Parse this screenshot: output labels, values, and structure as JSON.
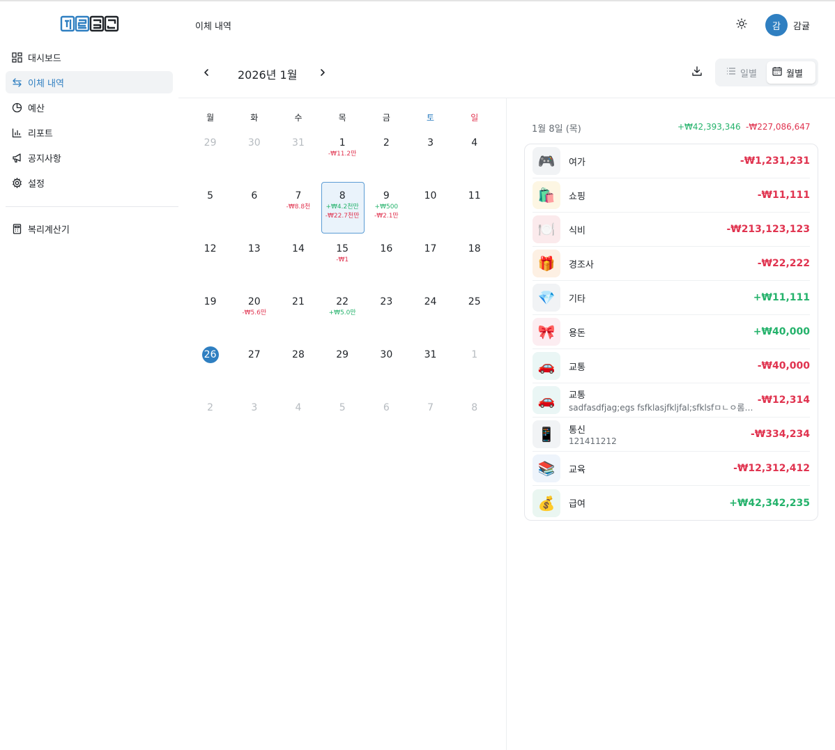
{
  "app": {
    "logo_text": "하루입금"
  },
  "sidebar": {
    "items": [
      {
        "label": "대시보드",
        "icon": "dashboard-icon",
        "active": false
      },
      {
        "label": "이체 내역",
        "icon": "transfer-icon",
        "active": true
      },
      {
        "label": "예산",
        "icon": "pie-chart-icon",
        "active": false
      },
      {
        "label": "리포트",
        "icon": "bar-chart-icon",
        "active": false
      },
      {
        "label": "공지사항",
        "icon": "megaphone-icon",
        "active": false
      },
      {
        "label": "설정",
        "icon": "gear-icon",
        "active": false
      }
    ],
    "tools": [
      {
        "label": "복리계산기",
        "icon": "calculator-icon"
      }
    ]
  },
  "header": {
    "title": "이체 내역",
    "avatar_initial": "감",
    "user_name": "감귤"
  },
  "calendar": {
    "month_label": "2026년 1월",
    "view_daily": "일별",
    "view_monthly": "월별",
    "selected_view": "월별",
    "weekdays": [
      "월",
      "화",
      "수",
      "목",
      "금",
      "토",
      "일"
    ],
    "days": [
      {
        "d": "29",
        "other": true
      },
      {
        "d": "30",
        "other": true
      },
      {
        "d": "31",
        "other": true
      },
      {
        "d": "1",
        "exp": "-₩11.2만"
      },
      {
        "d": "2"
      },
      {
        "d": "3"
      },
      {
        "d": "4"
      },
      {
        "d": "5"
      },
      {
        "d": "6"
      },
      {
        "d": "7",
        "exp": "-₩8.8천"
      },
      {
        "d": "8",
        "inc": "+₩4.2천만",
        "exp": "-₩22.7천만",
        "selected": true
      },
      {
        "d": "9",
        "inc": "+₩500",
        "exp": "-₩2.1만"
      },
      {
        "d": "10"
      },
      {
        "d": "11"
      },
      {
        "d": "12"
      },
      {
        "d": "13"
      },
      {
        "d": "14"
      },
      {
        "d": "15",
        "exp": "-₩1"
      },
      {
        "d": "16"
      },
      {
        "d": "17"
      },
      {
        "d": "18"
      },
      {
        "d": "19"
      },
      {
        "d": "20",
        "exp": "-₩5.6만"
      },
      {
        "d": "21"
      },
      {
        "d": "22",
        "inc": "+₩5.0만"
      },
      {
        "d": "23"
      },
      {
        "d": "24"
      },
      {
        "d": "25"
      },
      {
        "d": "26",
        "today": true
      },
      {
        "d": "27"
      },
      {
        "d": "28"
      },
      {
        "d": "29"
      },
      {
        "d": "30"
      },
      {
        "d": "31"
      },
      {
        "d": "1",
        "other": true
      },
      {
        "d": "2",
        "other": true
      },
      {
        "d": "3",
        "other": true
      },
      {
        "d": "4",
        "other": true
      },
      {
        "d": "5",
        "other": true
      },
      {
        "d": "6",
        "other": true
      },
      {
        "d": "7",
        "other": true
      },
      {
        "d": "8",
        "other": true
      }
    ]
  },
  "day_detail": {
    "date_label": "1월 8일 (목)",
    "income_total": "+₩42,393,346",
    "expense_total": "-₩227,086,647",
    "transactions": [
      {
        "emoji": "🎮",
        "bg": "#f1f3f5",
        "category": "여가",
        "memo": "",
        "amount": "-₩1,231,231",
        "type": "exp"
      },
      {
        "emoji": "🛍️",
        "bg": "#fdf6e3",
        "category": "쇼핑",
        "memo": "",
        "amount": "-₩11,111",
        "type": "exp"
      },
      {
        "emoji": "🍽️",
        "bg": "#fbeaec",
        "category": "식비",
        "memo": "",
        "amount": "-₩213,123,123",
        "type": "exp"
      },
      {
        "emoji": "🎁",
        "bg": "#fdf0e3",
        "category": "경조사",
        "memo": "",
        "amount": "-₩22,222",
        "type": "exp"
      },
      {
        "emoji": "💎",
        "bg": "#f1f3f5",
        "category": "기타",
        "memo": "",
        "amount": "+₩11,111",
        "type": "inc"
      },
      {
        "emoji": "🎀",
        "bg": "#fcedf1",
        "category": "용돈",
        "memo": "",
        "amount": "+₩40,000",
        "type": "inc"
      },
      {
        "emoji": "🚗",
        "bg": "#eaf6f5",
        "category": "교통",
        "memo": "",
        "amount": "-₩40,000",
        "type": "exp"
      },
      {
        "emoji": "🚗",
        "bg": "#eaf6f5",
        "category": "교통",
        "memo": "sadfasdfjag;egs fsfklasjfkljfal;sfklsfㅁㄴㅇ롬;널ㅁㄴㅇ로",
        "amount": "-₩12,314",
        "type": "exp"
      },
      {
        "emoji": "📱",
        "bg": "#f1f3f5",
        "category": "통신",
        "memo": "121411212",
        "amount": "-₩334,234",
        "type": "exp"
      },
      {
        "emoji": "📚",
        "bg": "#eef4fb",
        "category": "교육",
        "memo": "",
        "amount": "-₩12,312,412",
        "type": "exp"
      },
      {
        "emoji": "💰",
        "bg": "#eaf6f1",
        "category": "급여",
        "memo": "",
        "amount": "+₩42,342,235",
        "type": "inc"
      }
    ]
  },
  "colors": {
    "accent": "#2f7fc1",
    "income": "#24b26b",
    "expense": "#e0334f"
  }
}
